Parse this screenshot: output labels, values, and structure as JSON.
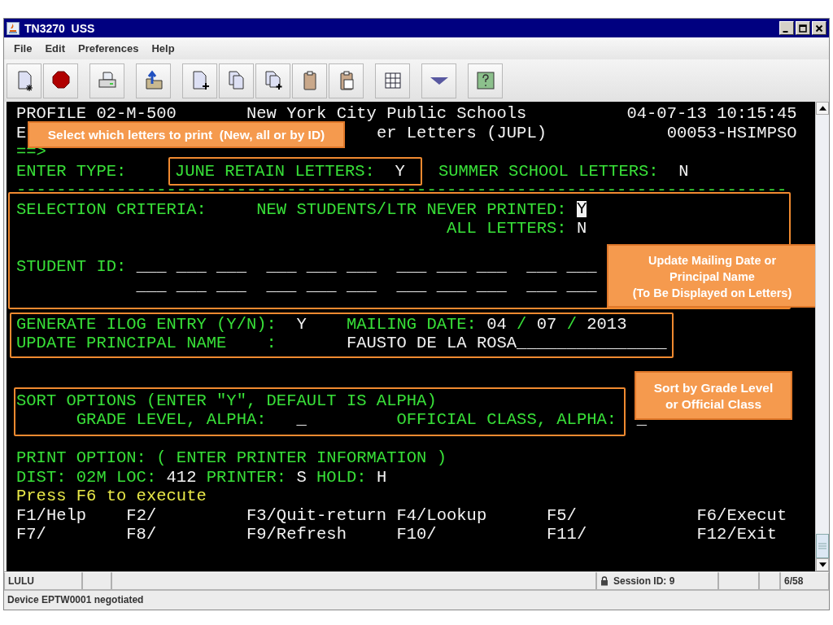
{
  "window": {
    "title": "TN3270  USS"
  },
  "menu": [
    "File",
    "Edit",
    "Preferences",
    "Help"
  ],
  "terminal": {
    "rows": [
      {
        "segments": [
          {
            "text": "PROFILE 02-M-500",
            "kind": "value"
          },
          {
            "text": "New York City Public Schools",
            "kind": "value"
          },
          {
            "text": "04-07-13 10:15:45",
            "kind": "value"
          }
        ]
      },
      {
        "segments": [
          {
            "text": "E",
            "kind": "value"
          },
          {
            "text": "er Letters (JUPL)",
            "kind": "value"
          },
          {
            "text": "00053-HSIMPSO",
            "kind": "value"
          }
        ]
      },
      {
        "segments": [
          {
            "text": "==>",
            "kind": "label"
          }
        ]
      },
      {
        "segments": [
          {
            "text": "ENTER TYPE:",
            "kind": "label"
          },
          {
            "text": "JUNE RETAIN LETTERS:",
            "kind": "label"
          },
          {
            "text": "Y",
            "kind": "value"
          },
          {
            "text": "SUMMER SCHOOL LETTERS:",
            "kind": "label"
          },
          {
            "text": "N",
            "kind": "value"
          }
        ]
      },
      {
        "segments": [
          {
            "text": "-----------------------------------------------------------------------------",
            "kind": "label"
          }
        ]
      },
      {
        "segments": [
          {
            "text": "SELECTION CRITERIA:",
            "kind": "label"
          },
          {
            "text": "NEW STUDENTS/LTR NEVER PRINTED:",
            "kind": "label"
          },
          {
            "text": "Y",
            "kind": "cursor"
          }
        ]
      },
      {
        "segments": [
          {
            "text": "ALL LETTERS:",
            "kind": "label"
          },
          {
            "text": "N",
            "kind": "value"
          }
        ]
      },
      {
        "segments": [
          {
            "text": "STUDENT ID:",
            "kind": "label"
          },
          {
            "text": "___",
            "kind": "value"
          },
          {
            "text": "___",
            "kind": "value"
          },
          {
            "text": "___",
            "kind": "value"
          },
          {
            "text": "___",
            "kind": "value"
          },
          {
            "text": "___",
            "kind": "value"
          },
          {
            "text": "___",
            "kind": "value"
          },
          {
            "text": "___",
            "kind": "value"
          },
          {
            "text": "___",
            "kind": "value"
          },
          {
            "text": "___",
            "kind": "value"
          },
          {
            "text": "___",
            "kind": "value"
          },
          {
            "text": "___",
            "kind": "value"
          }
        ]
      },
      {
        "segments": [
          {
            "text": "___",
            "kind": "value"
          },
          {
            "text": "___",
            "kind": "value"
          },
          {
            "text": "___",
            "kind": "value"
          },
          {
            "text": "___",
            "kind": "value"
          },
          {
            "text": "___",
            "kind": "value"
          },
          {
            "text": "___",
            "kind": "value"
          },
          {
            "text": "___",
            "kind": "value"
          },
          {
            "text": "___",
            "kind": "value"
          },
          {
            "text": "___",
            "kind": "value"
          },
          {
            "text": "___",
            "kind": "value"
          },
          {
            "text": "___",
            "kind": "value"
          }
        ]
      },
      {
        "segments": [
          {
            "text": "GENERATE ILOG ENTRY (Y/N):",
            "kind": "label"
          },
          {
            "text": "Y",
            "kind": "value"
          },
          {
            "text": "MAILING DATE:",
            "kind": "label"
          },
          {
            "text": "04",
            "kind": "value"
          },
          {
            "text": "/",
            "kind": "label"
          },
          {
            "text": "07",
            "kind": "value"
          },
          {
            "text": "/",
            "kind": "label"
          },
          {
            "text": "2013",
            "kind": "value"
          }
        ]
      },
      {
        "segments": [
          {
            "text": "UPDATE PRINCIPAL NAME",
            "kind": "label"
          },
          {
            "text": ":",
            "kind": "label"
          },
          {
            "text": "FAUSTO DE LA ROSA_______________",
            "kind": "value"
          }
        ]
      },
      {
        "segments": [
          {
            "text": "SORT OPTIONS (ENTER \"Y\", DEFAULT IS ALPHA)",
            "kind": "label"
          }
        ]
      },
      {
        "segments": [
          {
            "text": "GRADE LEVEL, ALPHA:",
            "kind": "label"
          },
          {
            "text": "_",
            "kind": "value"
          },
          {
            "text": "OFFICIAL CLASS, ALPHA:",
            "kind": "label"
          },
          {
            "text": "_",
            "kind": "value"
          }
        ]
      },
      {
        "segments": [
          {
            "text": "PRINT OPTION: ( ENTER PRINTER INFORMATION )",
            "kind": "label"
          }
        ]
      },
      {
        "segments": [
          {
            "text": "DIST:",
            "kind": "label"
          },
          {
            "text": "02M",
            "kind": "label"
          },
          {
            "text": "LOC:",
            "kind": "label"
          },
          {
            "text": "412",
            "kind": "value"
          },
          {
            "text": "PRINTER:",
            "kind": "label"
          },
          {
            "text": "S",
            "kind": "value"
          },
          {
            "text": "HOLD:",
            "kind": "label"
          },
          {
            "text": "H",
            "kind": "value"
          }
        ]
      },
      {
        "segments": [
          {
            "text": "Press F6 to execute",
            "kind": "prompt"
          }
        ]
      },
      {
        "segments": [
          {
            "text": "F1/Help",
            "kind": "value"
          },
          {
            "text": "F2/",
            "kind": "value"
          },
          {
            "text": "F3/Quit-return",
            "kind": "value"
          },
          {
            "text": "F4/Lookup",
            "kind": "value"
          },
          {
            "text": "F5/",
            "kind": "value"
          },
          {
            "text": "F6/Execut",
            "kind": "value"
          }
        ]
      },
      {
        "segments": [
          {
            "text": "F7/",
            "kind": "value"
          },
          {
            "text": "F8/",
            "kind": "value"
          },
          {
            "text": "F9/Refresh",
            "kind": "value"
          },
          {
            "text": "F10/",
            "kind": "value"
          },
          {
            "text": "F11/",
            "kind": "value"
          },
          {
            "text": "F12/Exit",
            "kind": "value"
          }
        ]
      }
    ]
  },
  "callouts": [
    {
      "lines": [
        "Select which letters to print  (New, all or by ID)"
      ]
    },
    {
      "lines": [
        "Update Mailing Date or",
        "Principal Name",
        "(To Be Displayed on Letters)"
      ]
    },
    {
      "lines": [
        "Sort by Grade Level",
        "or Official Class"
      ]
    }
  ],
  "status_bar": {
    "cells": [
      {
        "kind": "text",
        "text": "LULU"
      },
      {
        "kind": "blank"
      },
      {
        "kind": "blank"
      },
      {
        "kind": "session",
        "text": "Session ID: 9"
      },
      {
        "kind": "blank"
      },
      {
        "kind": "blank"
      },
      {
        "kind": "text",
        "text": "6/58"
      }
    ]
  },
  "message": "Device EPTW0001 negotiated"
}
